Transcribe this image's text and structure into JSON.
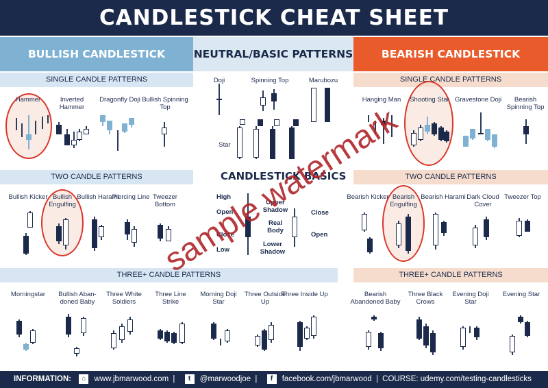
{
  "title": "CANDLESTICK CHEAT SHEET",
  "columns": {
    "bullish": "BULLISH CANDLESTICK PATTERNS",
    "neutral": "NEUTRAL/BASIC PATTERNS",
    "bearish": "BEARISH CANDLESTICK PATTERNS"
  },
  "bands": {
    "bull_single": "SINGLE CANDLE PATTERNS",
    "bull_two": "TWO CANDLE PATTERNS",
    "bull_three": "THREE+ CANDLE PATTERNS",
    "bear_single": "SINGLE CANDLE PATTERNS",
    "bear_two": "TWO CANDLE PATTERNS",
    "bear_three": "THREE+ CANDLE PATTERNS"
  },
  "bullish": {
    "single": [
      "Hammer",
      "Inverted Hammer",
      "Dragonfly Doji",
      "Bullish Spinning Top"
    ],
    "two": [
      "Bullish Kicker",
      "Bullish Engulfing",
      "Bullish Harami",
      "Piercing Line",
      "Tweezer Bottom"
    ],
    "three": [
      "Morningstar",
      "Bullish Aban-doned Baby",
      "Three White Soldiers",
      "Three Line Strike",
      "Morning Doji Star",
      "Three Outside Up",
      "Three Inside Up"
    ]
  },
  "neutral": {
    "labels": [
      "Doji",
      "Spinning Top",
      "Marubozu"
    ],
    "star": "Star",
    "basics_title": "CANDLESTICK BASICS",
    "basics": {
      "high": "High",
      "open_top": "Open",
      "close_left": "Close",
      "low": "Low",
      "upper_shadow": "Upper Shadow",
      "real_body": "Real Body",
      "lower_shadow": "Lower Shadow",
      "close_right": "Close",
      "open_right": "Open"
    }
  },
  "bearish": {
    "single": [
      "Hanging Man",
      "Shooting Star",
      "Gravestone Doji",
      "Bearish Spinning Top"
    ],
    "two": [
      "Bearish Kicker",
      "Bearish Engulfing",
      "Bearish Harami",
      "Dark Cloud Cover",
      "Tweezer Top"
    ],
    "three": [
      "Bearish Abandoned Baby",
      "Three Black Crows",
      "Evening Doji Star",
      "Evening Star"
    ]
  },
  "footer": {
    "information": "INFORMATION:",
    "website": "www.jbmarwood.com",
    "twitter": "@marwoodjoe",
    "facebook": "facebook.com/jbmarwood",
    "course": "COURSE: udemy.com/testing-candlesticks"
  },
  "watermark": "sample watermark",
  "colors": {
    "navy": "#1b2a4a",
    "light_blue": "#7fb1d3",
    "orange": "#e95b2b",
    "peach": "#f6dccd",
    "red_circle": "#d9362b"
  }
}
